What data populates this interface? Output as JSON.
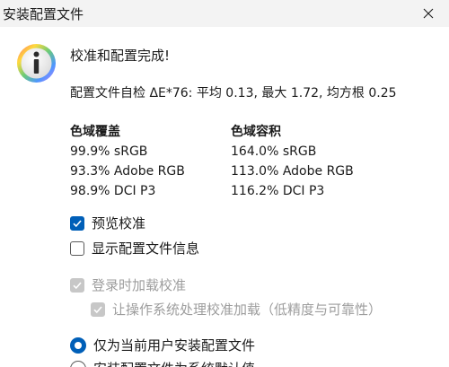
{
  "window": {
    "title": "安装配置文件",
    "close_glyph": "✕"
  },
  "icon": "info-icon",
  "heading": "校准和配置完成!",
  "summary": {
    "label": "配置文件自检 ΔE*76:",
    "average": "平均 0.13,",
    "max": "最大 1.72,",
    "rms": "均方根 0.25"
  },
  "gamut_coverage": {
    "title": "色域覆盖",
    "srgb": "99.9% sRGB",
    "adobe": "93.3% Adobe RGB",
    "p3": "98.9% DCI P3"
  },
  "gamut_volume": {
    "title": "色域容积",
    "srgb": "164.0% sRGB",
    "adobe": "113.0% Adobe RGB",
    "p3": "116.2% DCI P3"
  },
  "options": {
    "preview": {
      "label": "预览校准",
      "checked": true
    },
    "show_info": {
      "label": "显示配置文件信息",
      "checked": false
    },
    "load_at_login": {
      "label": "登录时加载校准",
      "checked": true,
      "disabled": true
    },
    "os_loading": {
      "label": "让操作系统处理校准加载（低精度与可靠性）",
      "checked": true,
      "disabled": true
    },
    "install_current_user": {
      "label": "仅为当前用户安装配置文件",
      "selected": true
    },
    "install_system_default": {
      "label": "安装配置文件为系统默认值",
      "selected": false
    }
  },
  "colors": {
    "accent": "#005fb8",
    "disabled": "#c7c7c7",
    "disabled_text": "#9d9d9d",
    "titlebar": "#f3f3f3"
  }
}
